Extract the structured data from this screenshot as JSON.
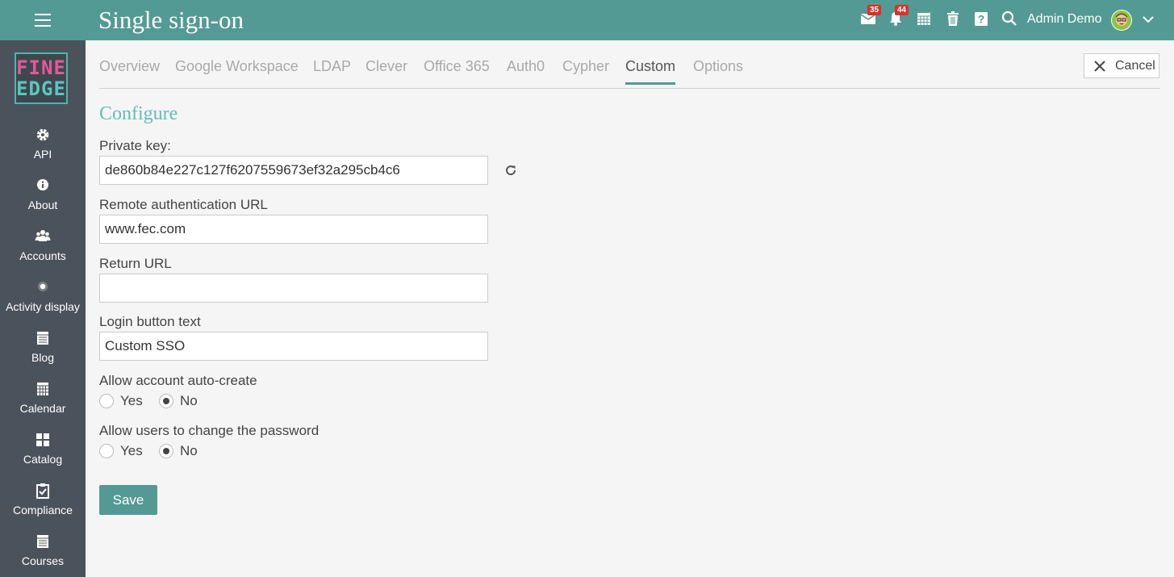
{
  "header": {
    "title": "Single sign-on",
    "messages_badge": "35",
    "notifications_badge": "44",
    "user_name": "Admin Demo",
    "accent_color": "#539a94"
  },
  "sidebar": {
    "logo_line1": "FINE",
    "logo_line2": "EDGE",
    "items": [
      {
        "label": "API",
        "icon": "gear-icon"
      },
      {
        "label": "About",
        "icon": "info-icon"
      },
      {
        "label": "Accounts",
        "icon": "users-icon"
      },
      {
        "label": "Activity display",
        "icon": "dot-circle-icon"
      },
      {
        "label": "Blog",
        "icon": "notebook-icon"
      },
      {
        "label": "Calendar",
        "icon": "calendar-icon"
      },
      {
        "label": "Catalog",
        "icon": "grid-icon"
      },
      {
        "label": "Compliance",
        "icon": "clipboard-check-icon"
      },
      {
        "label": "Courses",
        "icon": "book-icon"
      }
    ]
  },
  "tabs": [
    {
      "label": "Overview",
      "active": false
    },
    {
      "label": "Google Workspace",
      "active": false
    },
    {
      "label": "LDAP",
      "active": false
    },
    {
      "label": "Clever",
      "active": false
    },
    {
      "label": "Office 365",
      "active": false
    },
    {
      "label": "Auth0",
      "active": false
    },
    {
      "label": "Cypher",
      "active": false
    },
    {
      "label": "Custom",
      "active": true
    },
    {
      "label": "Options",
      "active": false
    }
  ],
  "cancel_label": "Cancel",
  "form": {
    "section_title": "Configure",
    "private_key_label": "Private key:",
    "private_key_value": "de860b84e227c127f6207559673ef32a295cb4c6",
    "remote_url_label": "Remote authentication URL",
    "remote_url_value": "www.fec.com",
    "return_url_label": "Return URL",
    "return_url_value": "",
    "login_text_label": "Login button text",
    "login_text_value": "Custom SSO",
    "auto_create_label": "Allow account auto-create",
    "auto_create_selected": "No",
    "change_password_label": "Allow users to change the password",
    "change_password_selected": "No",
    "yes_label": "Yes",
    "no_label": "No",
    "save_label": "Save"
  }
}
